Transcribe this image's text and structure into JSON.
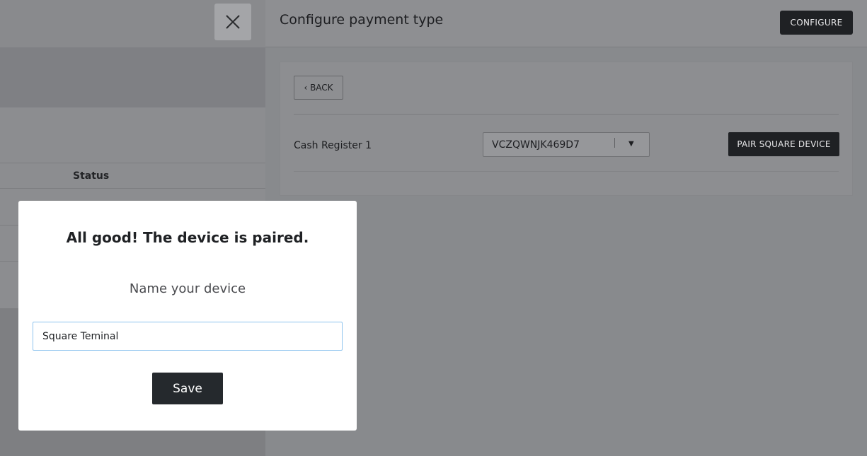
{
  "background": {
    "table_header_status": "Status"
  },
  "panel": {
    "title": "Configure payment type",
    "configure_label": "CONFIGURE",
    "back_label": "‹ BACK",
    "register_label": "Cash Register 1",
    "device_select_value": "VCZQWNJK469D7",
    "pair_label": "PAIR SQUARE DEVICE"
  },
  "modal": {
    "title": "All good! The device is paired.",
    "subtitle": "Name your device",
    "input_value": "Square Teminal",
    "save_label": "Save"
  },
  "icons": {
    "close": "close-icon",
    "dropdown": "caret-down-icon"
  },
  "colors": {
    "dark_button": "#1f2124",
    "modal_bg": "#ffffff",
    "input_focus_border": "#8ec4ee"
  }
}
